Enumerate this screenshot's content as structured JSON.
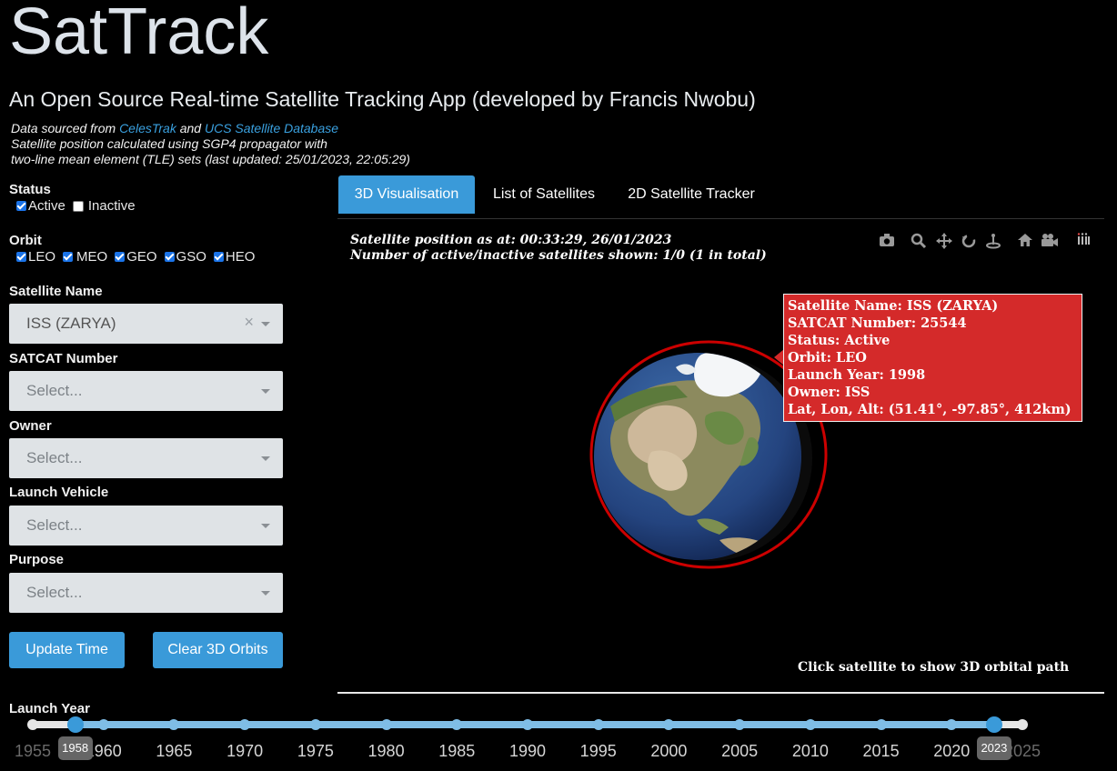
{
  "header": {
    "title": "SatTrack",
    "subtitle": "An Open Source Real-time Satellite Tracking App (developed by Francis Nwobu)",
    "source_prefix": "Data sourced from",
    "source_link1": "CelesTrak",
    "source_and": "and",
    "source_link2": "UCS Satellite Database",
    "source_line2": "Satellite position calculated using SGP4 propagator with",
    "source_line3": "two-line mean element (TLE) sets (last updated: 25/01/2023, 22:05:29)"
  },
  "filters": {
    "status_label": "Status",
    "status_options": [
      {
        "label": "Active",
        "checked": true
      },
      {
        "label": "Inactive",
        "checked": false
      }
    ],
    "orbit_label": "Orbit",
    "orbit_options": [
      {
        "label": "LEO",
        "checked": true
      },
      {
        "label": "MEO",
        "checked": true
      },
      {
        "label": "GEO",
        "checked": true
      },
      {
        "label": "GSO",
        "checked": true
      },
      {
        "label": "HEO",
        "checked": true
      }
    ],
    "satellite_name_label": "Satellite Name",
    "satellite_name_value": "ISS (ZARYA)",
    "satellite_name_clear": "×",
    "satcat_label": "SATCAT Number",
    "satcat_placeholder": "Select...",
    "owner_label": "Owner",
    "owner_placeholder": "Select...",
    "launch_vehicle_label": "Launch Vehicle",
    "launch_vehicle_placeholder": "Select...",
    "purpose_label": "Purpose",
    "purpose_placeholder": "Select..."
  },
  "buttons": {
    "update_time": "Update Time",
    "clear_orbits": "Clear 3D Orbits"
  },
  "tabs": [
    {
      "label": "3D Visualisation",
      "active": true
    },
    {
      "label": "List of Satellites",
      "active": false
    },
    {
      "label": "2D Satellite Tracker",
      "active": false
    }
  ],
  "visualisation": {
    "position_text": "Satellite position as at: 00:33:29, 26/01/2023",
    "count_text": "Number of active/inactive satellites shown: 1/0 (1 in total)",
    "hint": "Click satellite to show 3D orbital path",
    "modebar_icons": [
      "camera-icon",
      "zoom-icon",
      "pan-icon",
      "orbit-rotation-icon",
      "turntable-rotation-icon",
      "home-icon",
      "camera-reset-icon",
      "plotly-logo-icon"
    ],
    "tooltip": {
      "name": "Satellite Name: ISS (ZARYA)",
      "satcat": "SATCAT Number: 25544",
      "status": "Status: Active",
      "orbit": "Orbit: LEO",
      "launch_year": "Launch Year: 1998",
      "owner": "Owner: ISS",
      "latlonalt": "Lat, Lon, Alt: (51.41°, -97.85°, 412km)"
    },
    "colors": {
      "orbit": "#cc0000",
      "tooltip": "#d42a2a",
      "ocean": "#2a4e8e"
    }
  },
  "launch_year": {
    "label": "Launch Year",
    "min": 1955,
    "max": 2025,
    "selected_start": 1958,
    "selected_end": 2023,
    "marks": [
      "1955",
      "1960",
      "1965",
      "1970",
      "1975",
      "1980",
      "1985",
      "1990",
      "1995",
      "2000",
      "2005",
      "2010",
      "2015",
      "2020",
      "2025"
    ],
    "handle_start_label": "1958",
    "handle_end_label": "2023"
  }
}
